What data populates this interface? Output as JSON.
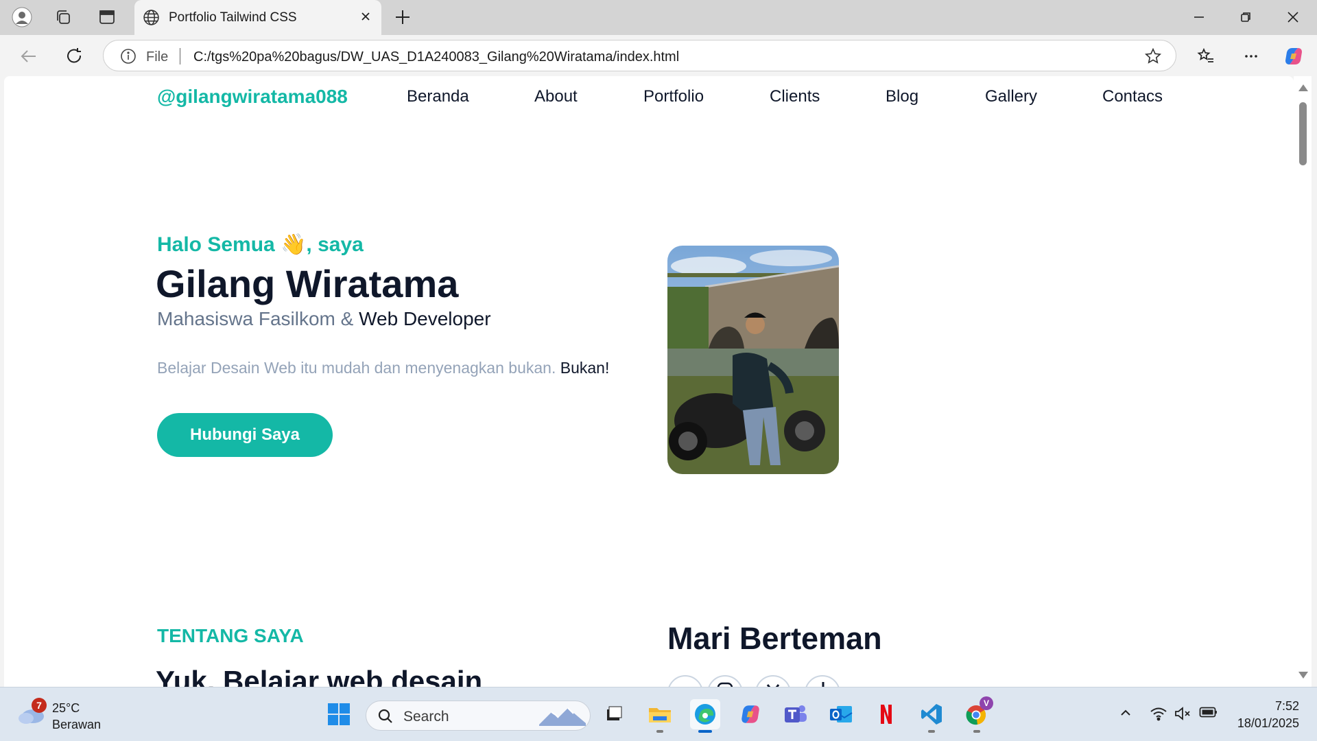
{
  "browser": {
    "tab_title": "Portfolio Tailwind CSS",
    "url_scheme": "File",
    "url": "C:/tgs%20pa%20bagus/DW_UAS_D1A240083_Gilang%20Wiratama/index.html"
  },
  "page": {
    "brand": "@gilangwiratama088",
    "nav": [
      "Beranda",
      "About",
      "Portfolio",
      "Clients",
      "Blog",
      "Gallery",
      "Contacs"
    ],
    "hero": {
      "greeting_pre": "Halo Semua ",
      "greeting_emoji": "👋",
      "greeting_post": ", saya",
      "name": "Gilang Wiratama",
      "role_part1": "Mahasiswa Fasilkom & ",
      "role_part2": "Web Developer",
      "tagline_part1": "Belajar Desain Web itu mudah dan menyenagkan bukan. ",
      "tagline_part2": "Bukan!",
      "cta": "Hubungi Saya"
    },
    "about": {
      "label": "TENTANG SAYA",
      "title": "Yuk, Belajar web desain"
    },
    "friends": {
      "title": "Mari Berteman"
    }
  },
  "taskbar": {
    "weather_badge": "7",
    "temperature": "25°C",
    "condition": "Berawan",
    "search_label": "Search",
    "time": "7:52",
    "date": "18/01/2025",
    "chrome_profile_badge": "V"
  },
  "colors": {
    "accent": "#14b8a6",
    "heading": "#0f172a",
    "muted": "#64748b"
  }
}
